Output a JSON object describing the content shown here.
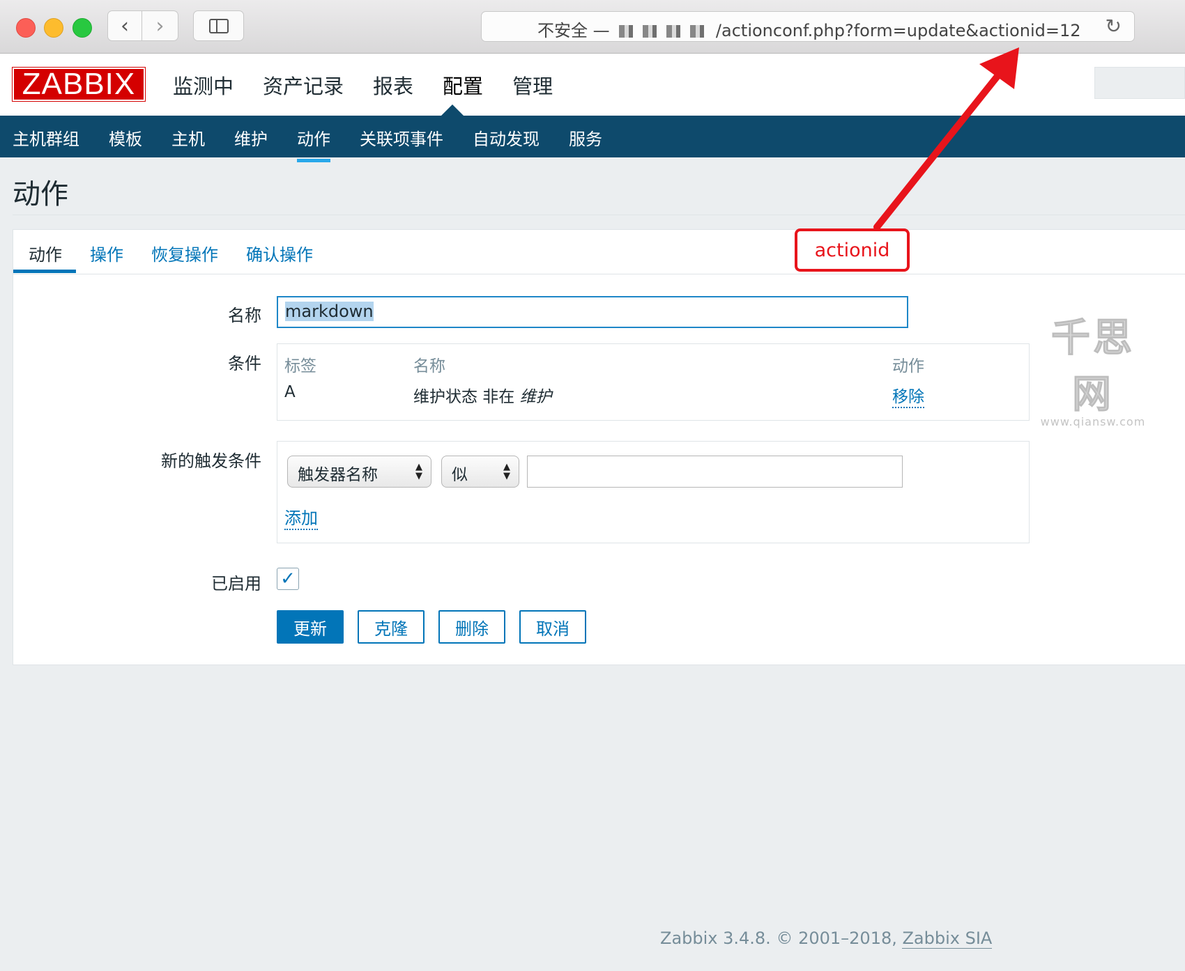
{
  "browser": {
    "url_prefix": "不安全 —",
    "url_path": "/actionconf.php?form=update&actionid=12"
  },
  "header": {
    "logo": "ZABBIX",
    "main_menu": [
      "监测中",
      "资产记录",
      "报表",
      "配置",
      "管理"
    ],
    "active_main": "配置"
  },
  "submenu": {
    "items": [
      "主机群组",
      "模板",
      "主机",
      "维护",
      "动作",
      "关联项事件",
      "自动发现",
      "服务"
    ],
    "active": "动作"
  },
  "page": {
    "title": "动作"
  },
  "tabs": [
    "动作",
    "操作",
    "恢复操作",
    "确认操作"
  ],
  "form": {
    "name_label": "名称",
    "name_value": "markdown",
    "conditions_label": "条件",
    "conditions_headers": {
      "tag": "标签",
      "name": "名称",
      "action": "动作"
    },
    "condition_row": {
      "tag": "A",
      "text": "维护状态 非在",
      "emph": "维护",
      "action": "移除"
    },
    "new_trigger_label": "新的触发条件",
    "trigger_select": "触发器名称",
    "operator_select": "似",
    "trigger_value": "",
    "add_link": "添加",
    "enabled_label": "已启用",
    "enabled": true,
    "buttons": {
      "update": "更新",
      "clone": "克隆",
      "delete": "删除",
      "cancel": "取消"
    }
  },
  "footer": {
    "text": "Zabbix 3.4.8. © 2001–2018, ",
    "company": "Zabbix SIA"
  },
  "annotation": {
    "label": "actionid",
    "color": "#e8141b"
  },
  "watermark": {
    "big": "千思网",
    "small": "www.qiansw.com"
  },
  "colors": {
    "brand_red": "#d40000",
    "nav_blue": "#0e4a6c",
    "link_blue": "#0275b8"
  }
}
